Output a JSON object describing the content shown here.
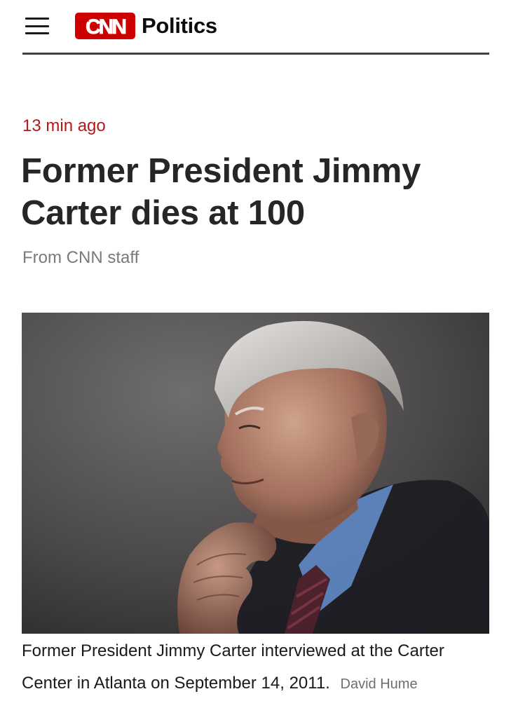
{
  "header": {
    "logo_text": "CNN",
    "section": "Politics"
  },
  "article": {
    "timestamp": "13 min ago",
    "headline": "Former President Jimmy Carter dies at 100",
    "byline": "From CNN staff",
    "caption": "Former President Jimmy Carter interviewed at the Carter Center in Atlanta on September 14, 2011.",
    "photo_credit": "David Hume"
  },
  "colors": {
    "brand_red": "#cc0000",
    "timestamp_red": "#b31919",
    "headline": "#262626"
  },
  "icons": {
    "menu": "hamburger-menu-icon"
  }
}
